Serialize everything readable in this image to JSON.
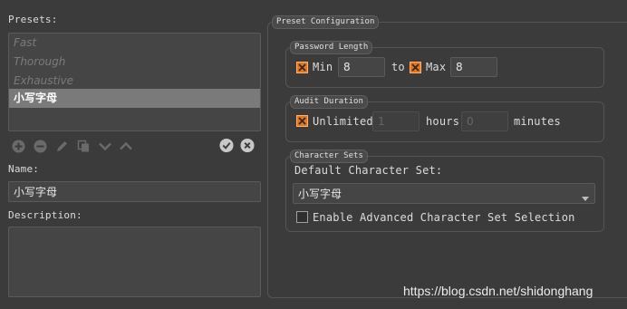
{
  "presets": {
    "label": "Presets:",
    "items": [
      {
        "label": "Fast",
        "selected": false
      },
      {
        "label": "Thorough",
        "selected": false
      },
      {
        "label": "Exhaustive",
        "selected": false
      },
      {
        "label": "小写字母",
        "selected": true
      }
    ],
    "toolbar_icons": [
      "add-icon",
      "remove-icon",
      "edit-icon",
      "copy-icon",
      "move-down-icon",
      "move-up-icon",
      "accept-icon",
      "cancel-icon"
    ]
  },
  "name": {
    "label": "Name:",
    "value": "小写字母"
  },
  "description": {
    "label": "Description:",
    "value": ""
  },
  "config": {
    "title": "Preset Configuration",
    "password_length": {
      "title": "Password Length",
      "min_label": "Min",
      "min_checked": true,
      "min_value": "8",
      "to_label": "to",
      "max_label": "Max",
      "max_checked": true,
      "max_value": "8"
    },
    "audit_duration": {
      "title": "Audit Duration",
      "unlimited_label": "Unlimited",
      "unlimited_checked": true,
      "hours_value": "1",
      "hours_label": "hours",
      "minutes_value": "0",
      "minutes_label": "minutes"
    },
    "character_sets": {
      "title": "Character Sets",
      "default_label": "Default Character Set:",
      "default_value": "小写字母",
      "advanced_label": "Enable Advanced Character Set Selection",
      "advanced_checked": false
    }
  },
  "watermark": "https://blog.csdn.net/shidonghang",
  "colors": {
    "accent": "#e8751a",
    "background": "#3b3b3b",
    "selection": "#7a7a7a"
  }
}
